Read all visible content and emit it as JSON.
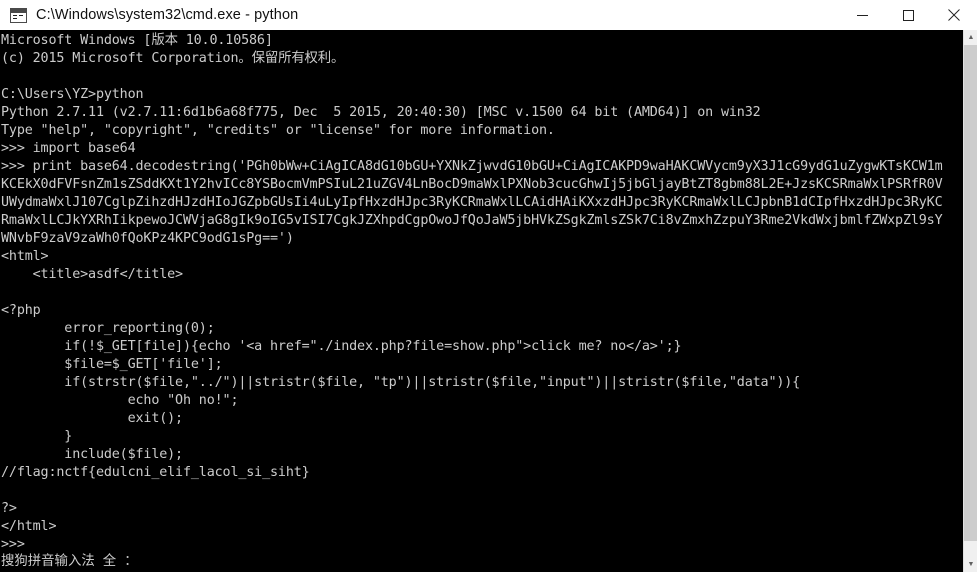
{
  "window": {
    "title": "C:\\Windows\\system32\\cmd.exe - python",
    "icon": "cmd-console-icon",
    "background_color": "#000000",
    "titlebar_color": "#ffffff",
    "text_color": "#cccccc",
    "controls": {
      "minimize_label": "Minimize",
      "maximize_label": "Maximize",
      "close_label": "Close"
    }
  },
  "console": {
    "lines": [
      "Microsoft Windows [版本 10.0.10586]",
      "(c) 2015 Microsoft Corporation。保留所有权利。",
      "",
      "C:\\Users\\YZ>python",
      "Python 2.7.11 (v2.7.11:6d1b6a68f775, Dec  5 2015, 20:40:30) [MSC v.1500 64 bit (AMD64)] on win32",
      "Type \"help\", \"copyright\", \"credits\" or \"license\" for more information.",
      ">>> import base64",
      ">>> print base64.decodestring('PGh0bWw+CiAgICA8dG10bGU+YXNkZjwvdG10bGU+CiAgICAKPD9waHAKCWVycm9yX3J1cG9ydG1uZygwKTsKCW1mKCEkX0dFVFsnZm1sZSddKXt1Y2hvICc8YSBocmVmPSIuL21uZGV4LnBocD9maWxlPXNob3cucGhwIj5jbGljayBtZT8gbm88L2E+JzsKCSRmaWxlPSRfR0VUWydmaWxlJ107CglpZihzdHJzdHIoJGZpbGUsIi4uLyIpfHxzdHJpc3RyKCRmaWxlLCAidHAiKXxzdHJpc3RyKCRmaWxlLCJpbnB1dCIpfHxzdHJpc3RyKCRmaWxlLCJkYXRhIikpewoJCWVjaG8gIk9oIG5vISI7CgkJZXhpdCgpOwoJfQoJaW5jbHVkZSgkZmlsZSk7Ci8vZmxhZzpuY3Rme2VkdWxjbmlfZWxpZl9sYWNvbF9zaV9zaWh0fQoKPz4KPC9odG1sPg==')",
      "<html>",
      "    <title>asdf</title>",
      "",
      "<?php",
      "\terror_reporting(0);",
      "\tif(!$_GET[file]){echo '<a href=\"./index.php?file=show.php\">click me? no</a>';}",
      "\t$file=$_GET['file'];",
      "\tif(strstr($file,\"../\")||stristr($file, \"tp\")||stristr($file,\"input\")||stristr($file,\"data\")){",
      "\t\techo \"Oh no!\";",
      "\t\texit();",
      "\t}",
      "\tinclude($file);",
      "//flag:nctf{edulcni_elif_lacol_si_siht}",
      "",
      "?>",
      "</html>",
      ">>>"
    ]
  },
  "ime": {
    "status_text": "搜狗拼音输入法 全 ："
  },
  "scrollbar": {
    "up_arrow": "▲",
    "down_arrow": "▼"
  }
}
